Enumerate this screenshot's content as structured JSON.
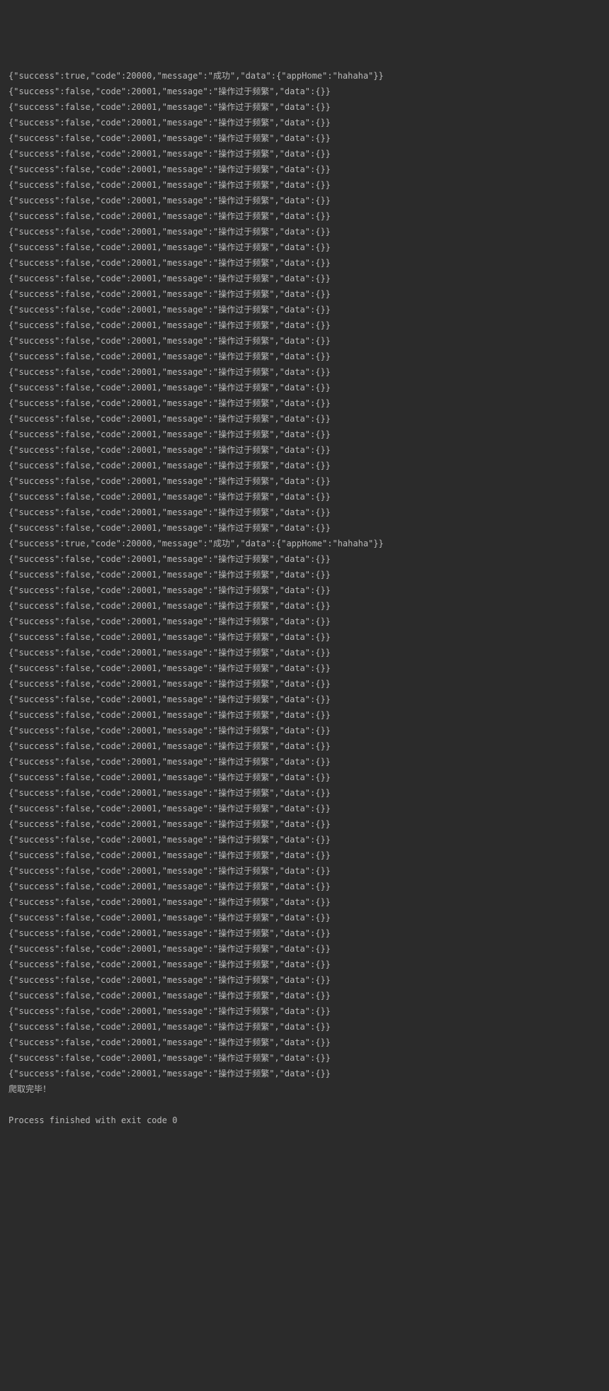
{
  "console": {
    "success_line": "{\"success\":true,\"code\":20000,\"message\":\"成功\",\"data\":{\"appHome\":\"hahaha\"}}",
    "fail_line": "{\"success\":false,\"code\":20001,\"message\":\"操作过于频繁\",\"data\":{}}",
    "block1_success_count": 1,
    "block1_fail_count": 29,
    "block2_success_count": 1,
    "block2_fail_count": 34,
    "done_line": "爬取完毕！",
    "blank_line": " ",
    "exit_line": "Process finished with exit code 0"
  }
}
